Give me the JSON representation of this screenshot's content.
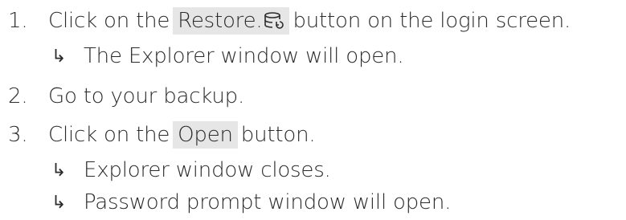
{
  "steps": [
    {
      "number": "1.",
      "before": "Click on the",
      "button": "Restore.",
      "button_icon": "database-restore-icon",
      "after": "button on the login screen.",
      "results": [
        "The Explorer window will open."
      ]
    },
    {
      "number": "2.",
      "text": "Go to your backup."
    },
    {
      "number": "3.",
      "before": "Click on the",
      "button": "Open",
      "after": "button.",
      "results": [
        "Explorer window closes.",
        "Password prompt window will open."
      ]
    }
  ],
  "result_arrow": "↳",
  "colors": {
    "text": "#2b2b2b",
    "button_bg": "#e6e6e6"
  }
}
